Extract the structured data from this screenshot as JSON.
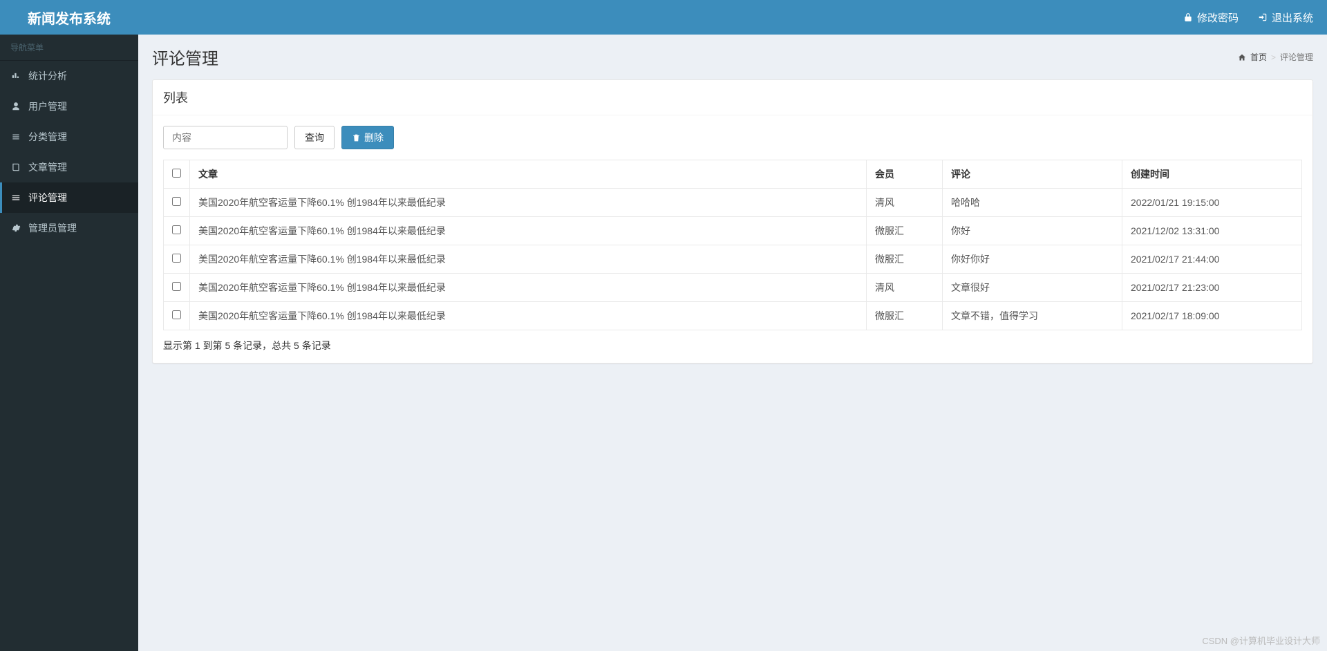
{
  "brand": "新闻发布系统",
  "topbar": {
    "change_password": "修改密码",
    "logout": "退出系统"
  },
  "sidebar": {
    "header": "导航菜单",
    "items": [
      {
        "label": "统计分析",
        "icon": "bar-chart-icon"
      },
      {
        "label": "用户管理",
        "icon": "user-icon"
      },
      {
        "label": "分类管理",
        "icon": "list-icon"
      },
      {
        "label": "文章管理",
        "icon": "book-icon"
      },
      {
        "label": "评论管理",
        "icon": "menu-icon"
      },
      {
        "label": "管理员管理",
        "icon": "gear-icon"
      }
    ],
    "active_index": 4
  },
  "page": {
    "title": "评论管理",
    "breadcrumb_home": "首页",
    "breadcrumb_current": "评论管理"
  },
  "panel": {
    "header": "列表",
    "search_placeholder": "内容",
    "search_btn": "查询",
    "delete_btn": "删除"
  },
  "table": {
    "columns": {
      "article": "文章",
      "member": "会员",
      "comment": "评论",
      "created": "创建时间"
    },
    "rows": [
      {
        "article": "美国2020年航空客运量下降60.1% 创1984年以来最低纪录",
        "member": "清风",
        "comment": "哈哈哈",
        "created": "2022/01/21 19:15:00"
      },
      {
        "article": "美国2020年航空客运量下降60.1% 创1984年以来最低纪录",
        "member": "微服汇",
        "comment": "你好",
        "created": "2021/12/02 13:31:00"
      },
      {
        "article": "美国2020年航空客运量下降60.1% 创1984年以来最低纪录",
        "member": "微服汇",
        "comment": "你好你好",
        "created": "2021/02/17 21:44:00"
      },
      {
        "article": "美国2020年航空客运量下降60.1% 创1984年以来最低纪录",
        "member": "清风",
        "comment": "文章很好",
        "created": "2021/02/17 21:23:00"
      },
      {
        "article": "美国2020年航空客运量下降60.1% 创1984年以来最低纪录",
        "member": "微服汇",
        "comment": "文章不错，值得学习",
        "created": "2021/02/17 18:09:00"
      }
    ],
    "info": "显示第 1 到第 5 条记录，总共 5 条记录"
  },
  "watermark": "CSDN @计算机毕业设计大师"
}
